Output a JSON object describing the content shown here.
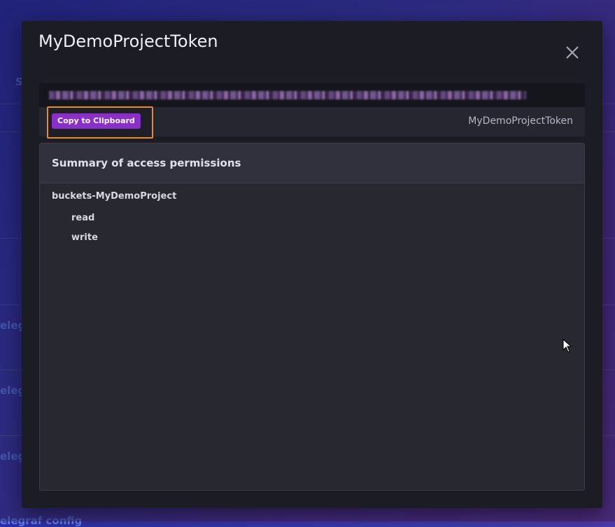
{
  "background": {
    "fragments": [
      "S",
      "elegr",
      "elegr",
      "elegr",
      "elegraf config"
    ]
  },
  "modal": {
    "title": "MyDemoProjectToken",
    "close_icon": "close-icon",
    "token": {
      "copy_label": "Copy to Clipboard",
      "name": "MyDemoProjectToken"
    },
    "permissions": {
      "title": "Summary of access permissions",
      "buckets": [
        {
          "name": "buckets-MyDemoProject",
          "permissions": [
            "read",
            "write"
          ]
        }
      ]
    }
  },
  "colors": {
    "accent": "#8b2fc9",
    "highlight": "#e58a2f",
    "modal_bg": "#1b1c24"
  }
}
